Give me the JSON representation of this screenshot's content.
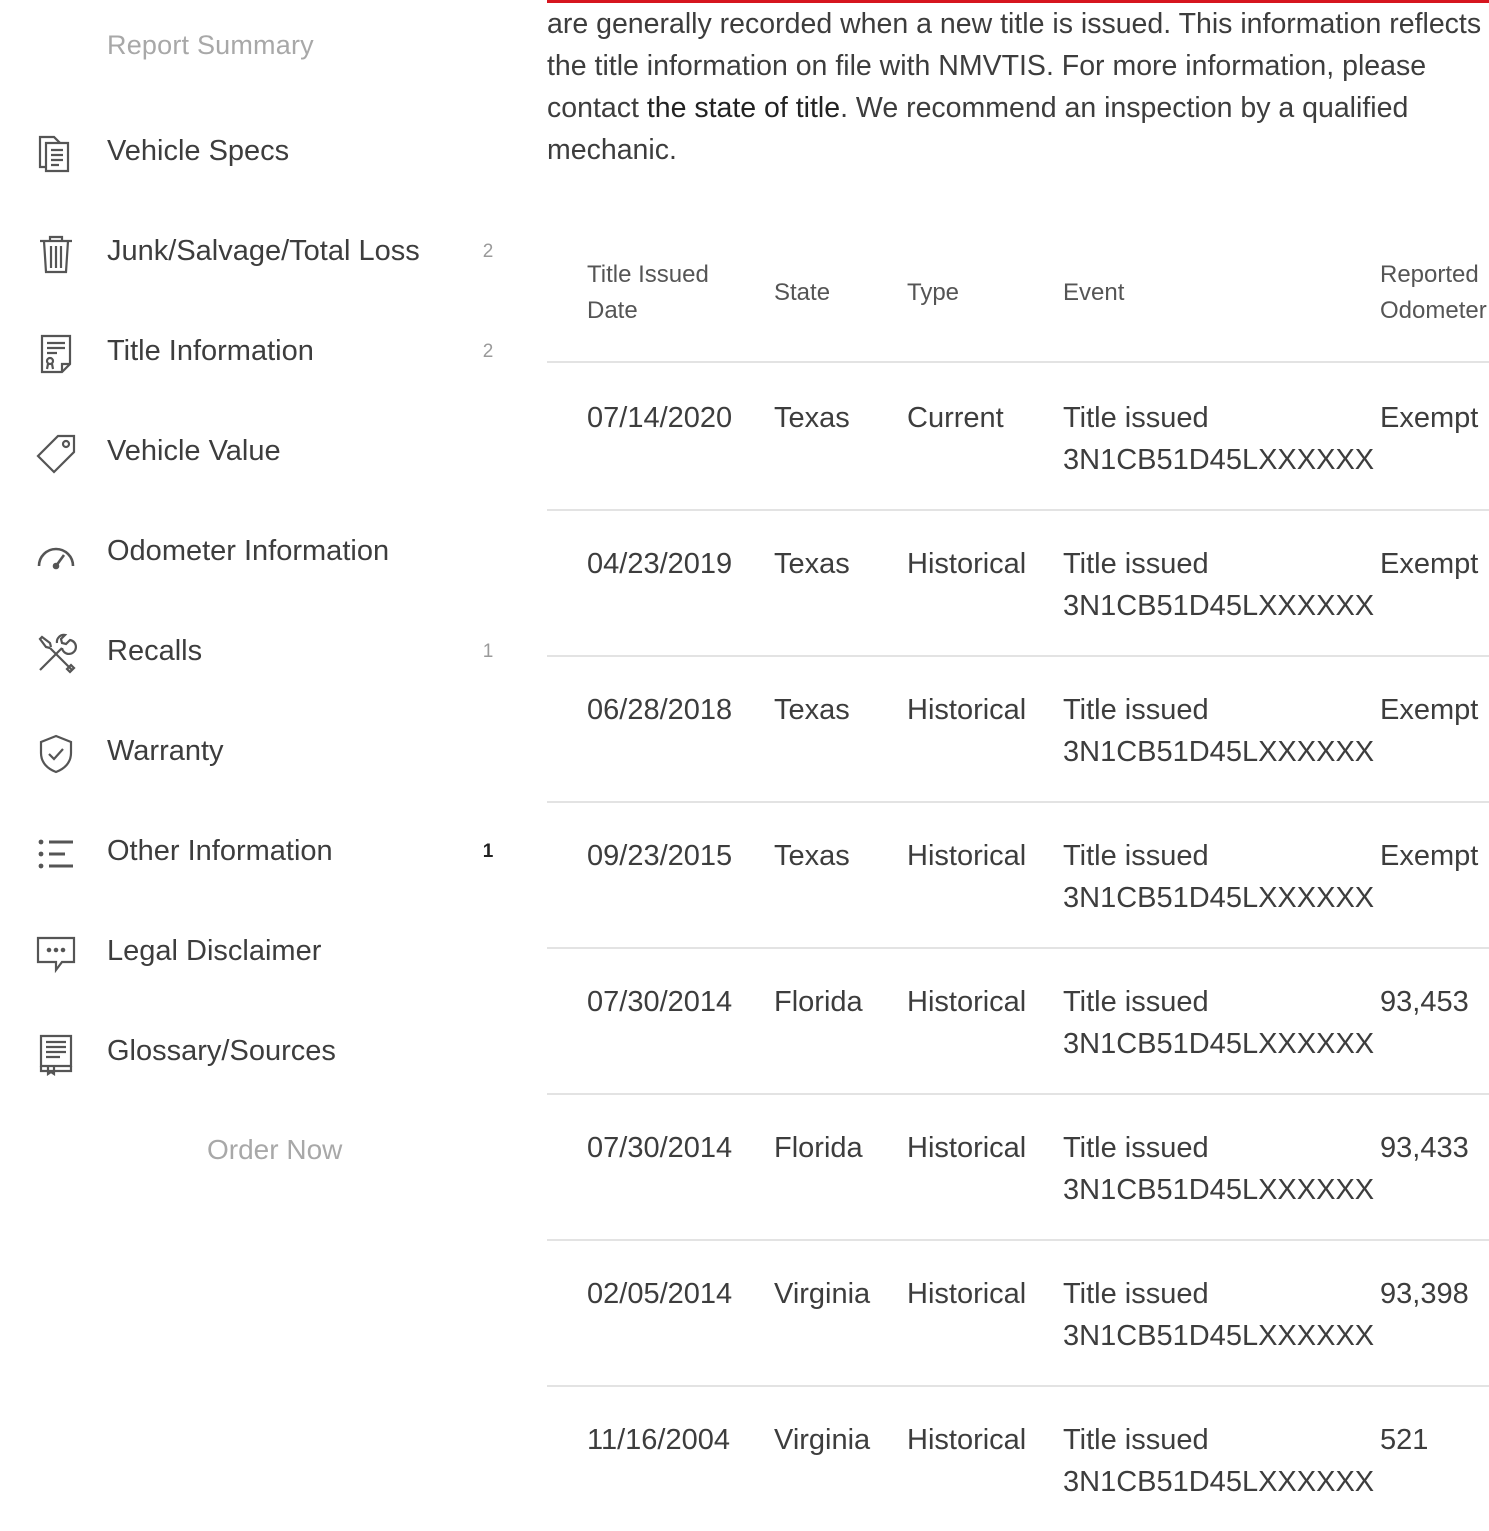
{
  "sidebar": {
    "summary_label": "Report Summary",
    "items": [
      {
        "label": "Vehicle Specs",
        "icon": "document-copy-icon",
        "badge": ""
      },
      {
        "label": "Junk/Salvage/Total Loss",
        "icon": "trash-icon",
        "badge": "2"
      },
      {
        "label": "Title Information",
        "icon": "certificate-icon",
        "badge": "2"
      },
      {
        "label": "Vehicle Value",
        "icon": "price-tag-icon",
        "badge": ""
      },
      {
        "label": "Odometer Information",
        "icon": "speedometer-icon",
        "badge": ""
      },
      {
        "label": "Recalls",
        "icon": "wrench-screwdriver-icon",
        "badge": "1"
      },
      {
        "label": "Warranty",
        "icon": "shield-check-icon",
        "badge": ""
      },
      {
        "label": "Other Information",
        "icon": "list-icon",
        "badge": "1"
      },
      {
        "label": "Legal Disclaimer",
        "icon": "chat-bubble-icon",
        "badge": ""
      },
      {
        "label": "Glossary/Sources",
        "icon": "book-icon",
        "badge": ""
      }
    ],
    "order_label": "Order Now"
  },
  "main": {
    "accent_color": "#d6151f",
    "intro_part1": "are generally recorded when a new title is issued. This information reflects the title information on file with NMVTIS. For more information, please contact ",
    "intro_link": "the state of title",
    "intro_part2": ". We recommend an inspection by a qualified mechanic.",
    "table": {
      "headers": {
        "date": [
          "Title Issued",
          "Date"
        ],
        "state": "State",
        "type": "Type",
        "event": "Event",
        "odometer": [
          "Reported",
          "Odometer"
        ]
      },
      "rows": [
        {
          "date": "07/14/2020",
          "state": "Texas",
          "type": "Current",
          "event": "Title issued",
          "vin": "3N1CB51D45LXXXXXX",
          "odometer": "Exempt"
        },
        {
          "date": "04/23/2019",
          "state": "Texas",
          "type": "Historical",
          "event": "Title issued",
          "vin": "3N1CB51D45LXXXXXX",
          "odometer": "Exempt"
        },
        {
          "date": "06/28/2018",
          "state": "Texas",
          "type": "Historical",
          "event": "Title issued",
          "vin": "3N1CB51D45LXXXXXX",
          "odometer": "Exempt"
        },
        {
          "date": "09/23/2015",
          "state": "Texas",
          "type": "Historical",
          "event": "Title issued",
          "vin": "3N1CB51D45LXXXXXX",
          "odometer": "Exempt"
        },
        {
          "date": "07/30/2014",
          "state": "Florida",
          "type": "Historical",
          "event": "Title issued",
          "vin": "3N1CB51D45LXXXXXX",
          "odometer": "93,453"
        },
        {
          "date": "07/30/2014",
          "state": "Florida",
          "type": "Historical",
          "event": "Title issued",
          "vin": "3N1CB51D45LXXXXXX",
          "odometer": "93,433"
        },
        {
          "date": "02/05/2014",
          "state": "Virginia",
          "type": "Historical",
          "event": "Title issued",
          "vin": "3N1CB51D45LXXXXXX",
          "odometer": "93,398"
        },
        {
          "date": "11/16/2004",
          "state": "Virginia",
          "type": "Historical",
          "event": "Title issued",
          "vin": "3N1CB51D45LXXXXXX",
          "odometer": "521"
        }
      ]
    }
  }
}
